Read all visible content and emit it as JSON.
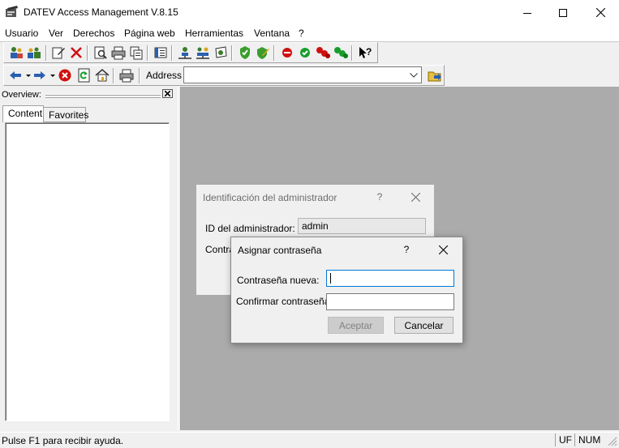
{
  "window": {
    "title": "DATEV Access Management V.8.15",
    "controls": {
      "minimize": "minimize-icon",
      "maximize": "maximize-icon",
      "close": "close-icon"
    }
  },
  "menu": {
    "items": [
      "Usuario",
      "Ver",
      "Derechos",
      "Página web",
      "Herramientas",
      "Ventana",
      "?"
    ]
  },
  "toolbar1": {
    "icons": [
      "users-icon",
      "group-users-icon",
      "edit-document-icon",
      "delete-x-icon",
      "print-preview-icon",
      "print-icon",
      "copy-print-icon",
      "properties-icon",
      "network-user-icon",
      "network-group-icon",
      "certificate-icon",
      "shield-check-icon",
      "shield-edit-icon",
      "stop-red-icon",
      "check-green-icon",
      "rights-deny-icon",
      "rights-allow-icon",
      "context-help-icon"
    ]
  },
  "toolbar2": {
    "icons": [
      "back-arrow-icon",
      "forward-arrow-icon",
      "stop-icon",
      "refresh-icon",
      "home-icon",
      "print-icon",
      "go-folder-icon"
    ],
    "address_label": "Address",
    "address_value": ""
  },
  "overview": {
    "label": "Overview:",
    "tabs": [
      "Content",
      "Favorites"
    ]
  },
  "admin_dialog": {
    "title": "Identificación del administrador",
    "help": "?",
    "id_label": "ID del administrador:",
    "id_value": "admin",
    "password_label_partial": "Contra"
  },
  "set_password_dialog": {
    "title": "Asignar contraseña",
    "help": "?",
    "new_password_label": "Contraseña nueva:",
    "new_password_value": "",
    "confirm_password_label": "Confirmar contraseña:",
    "confirm_password_value": "",
    "accept_label": "Aceptar",
    "cancel_label": "Cancelar"
  },
  "statusbar": {
    "text": "Pulse F1 para recibir ayuda.",
    "indicators": [
      "UF",
      "NUM"
    ]
  },
  "colors": {
    "mdi_background": "#ababab",
    "focus_border": "#0078d7",
    "disabled_button": "#cccccc"
  }
}
